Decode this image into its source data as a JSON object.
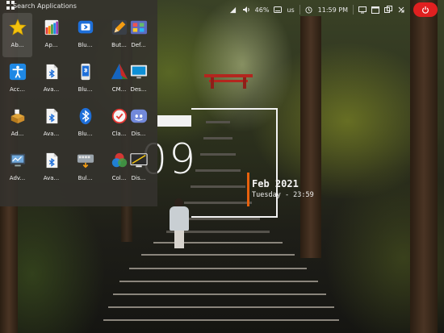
{
  "app_menu": {
    "search_placeholder": "Search Applications",
    "apps": [
      {
        "label": "Ab...",
        "icon": "star-icon"
      },
      {
        "label": "Ap...",
        "icon": "color-palette-icon"
      },
      {
        "label": "Blu...",
        "icon": "bluetooth-device-icon"
      },
      {
        "label": "But...",
        "icon": "pencil-icon"
      },
      {
        "label": "Def...",
        "icon": "default-apps-icon"
      },
      {
        "label": "Acc...",
        "icon": "accessibility-icon"
      },
      {
        "label": "Ava...",
        "icon": "blueman-icon"
      },
      {
        "label": "Blu...",
        "icon": "bluetooth-phone-icon"
      },
      {
        "label": "CM...",
        "icon": "cmake-icon"
      },
      {
        "label": "Des...",
        "icon": "desktop-monitor-icon"
      },
      {
        "label": "Ad...",
        "icon": "package-icon"
      },
      {
        "label": "Ava...",
        "icon": "blueman-icon"
      },
      {
        "label": "Blu...",
        "icon": "bluetooth-icon"
      },
      {
        "label": "Cla...",
        "icon": "clamtk-icon"
      },
      {
        "label": "Dis...",
        "icon": "discord-icon"
      },
      {
        "label": "Adv...",
        "icon": "network-monitor-icon"
      },
      {
        "label": "Ava...",
        "icon": "blueman-icon"
      },
      {
        "label": "Bul...",
        "icon": "bulk-rename-icon"
      },
      {
        "label": "Col...",
        "icon": "color-picker-icon"
      },
      {
        "label": "Dis...",
        "icon": "display-icon"
      }
    ]
  },
  "status_bar": {
    "volume_percent": "46%",
    "keyboard_layout": "us",
    "time": "11:59 PM"
  },
  "clock_widget": {
    "big_digits": "09",
    "date_main": "Feb 2021",
    "date_sub": "Tuesday - 23:59"
  },
  "colors": {
    "accent": "#e8610d",
    "power_button": "#e02020",
    "menu_bg": "#34322e"
  }
}
